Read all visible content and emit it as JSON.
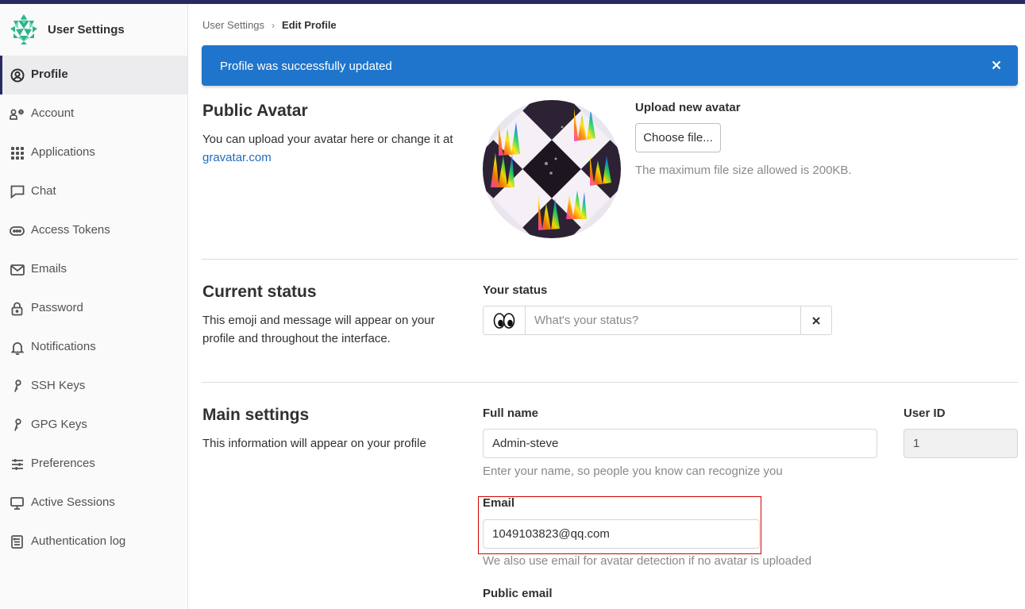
{
  "sidebar": {
    "title": "User Settings",
    "items": [
      {
        "label": "Profile",
        "icon": "profile-icon",
        "active": true
      },
      {
        "label": "Account",
        "icon": "account-icon"
      },
      {
        "label": "Applications",
        "icon": "applications-icon"
      },
      {
        "label": "Chat",
        "icon": "chat-icon"
      },
      {
        "label": "Access Tokens",
        "icon": "token-icon"
      },
      {
        "label": "Emails",
        "icon": "mail-icon"
      },
      {
        "label": "Password",
        "icon": "lock-icon"
      },
      {
        "label": "Notifications",
        "icon": "bell-icon"
      },
      {
        "label": "SSH Keys",
        "icon": "key-icon"
      },
      {
        "label": "GPG Keys",
        "icon": "key-icon"
      },
      {
        "label": "Preferences",
        "icon": "preferences-icon"
      },
      {
        "label": "Active Sessions",
        "icon": "monitor-icon"
      },
      {
        "label": "Authentication log",
        "icon": "log-icon"
      }
    ]
  },
  "breadcrumb": {
    "parent": "User Settings",
    "current": "Edit Profile"
  },
  "alert": {
    "message": "Profile was successfully updated"
  },
  "avatar_section": {
    "title": "Public Avatar",
    "description": "You can upload your avatar here or change it at",
    "link": "gravatar.com",
    "upload_label": "Upload new avatar",
    "choose_button": "Choose file...",
    "max_size_hint": "The maximum file size allowed is 200KB."
  },
  "status_section": {
    "title": "Current status",
    "description": "This emoji and message will appear on your profile and throughout the interface.",
    "your_status_label": "Your status",
    "emoji": "eyes",
    "placeholder": "What's your status?"
  },
  "main_settings": {
    "title": "Main settings",
    "description": "This information will appear on your profile",
    "full_name_label": "Full name",
    "full_name_value": "Admin-steve",
    "full_name_hint": "Enter your name, so people you know can recognize you",
    "user_id_label": "User ID",
    "user_id_value": "1",
    "email_label": "Email",
    "email_value": "1049103823@qq.com",
    "email_hint": "We also use email for avatar detection if no avatar is uploaded",
    "public_email_label": "Public email"
  },
  "colors": {
    "accent": "#292961",
    "alert_bg": "#1f75cb",
    "link": "#1f6bbf",
    "highlight": "#d40000"
  }
}
